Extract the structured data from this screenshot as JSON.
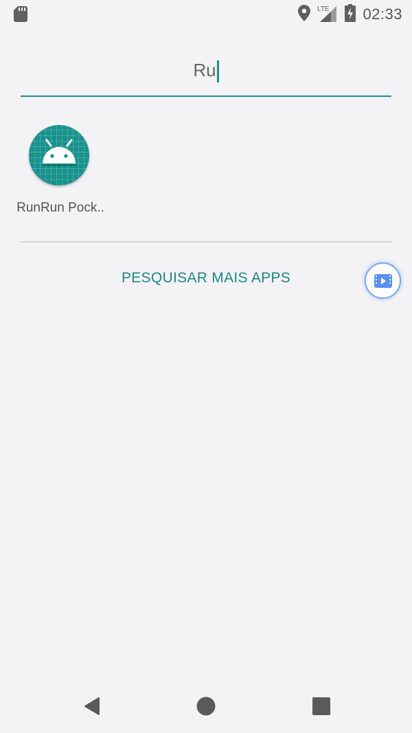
{
  "status_bar": {
    "time": "02:33",
    "network": "LTE",
    "icons": [
      "sd-card-icon",
      "location-icon",
      "signal-icon",
      "battery-charging-icon"
    ]
  },
  "search": {
    "query": "Ru"
  },
  "results": [
    {
      "label": "RunRun Pock..",
      "icon": "android-app-icon"
    }
  ],
  "more_apps_label": "PESQUISAR MAIS APPS",
  "floating_button": {
    "icon": "screen-recorder-icon"
  },
  "nav": {
    "icons": [
      "back-icon",
      "home-icon",
      "recents-icon"
    ]
  },
  "colors": {
    "accent": "#1d8a8c",
    "background": "#f3f2f5",
    "app_icon": "#17928c",
    "float_border": "#7aa6f5"
  }
}
